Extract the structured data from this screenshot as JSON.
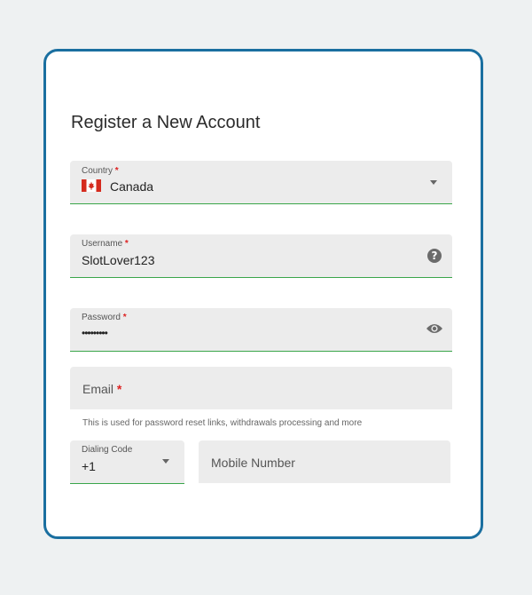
{
  "form": {
    "title": "Register a New Account",
    "country": {
      "label": "Country",
      "required_mark": "*",
      "value": "Canada",
      "flag_icon": "canada-flag-icon"
    },
    "username": {
      "label": "Username",
      "required_mark": "*",
      "value": "SlotLover123",
      "icon": "help-icon"
    },
    "password": {
      "label": "Password",
      "required_mark": "*",
      "value": "•••••••••",
      "icon": "eye-icon"
    },
    "email": {
      "label": "Email",
      "required_mark": "*",
      "helper": "This is used for password reset links, withdrawals processing and more"
    },
    "dialing_code": {
      "label": "Dialing Code",
      "value": "+1"
    },
    "mobile": {
      "placeholder": "Mobile Number"
    }
  },
  "colors": {
    "card_border": "#1a6fa0",
    "valid_underline": "#3aa64a",
    "required": "#dd2222",
    "field_bg": "#ececec",
    "page_bg": "#eef1f2"
  }
}
